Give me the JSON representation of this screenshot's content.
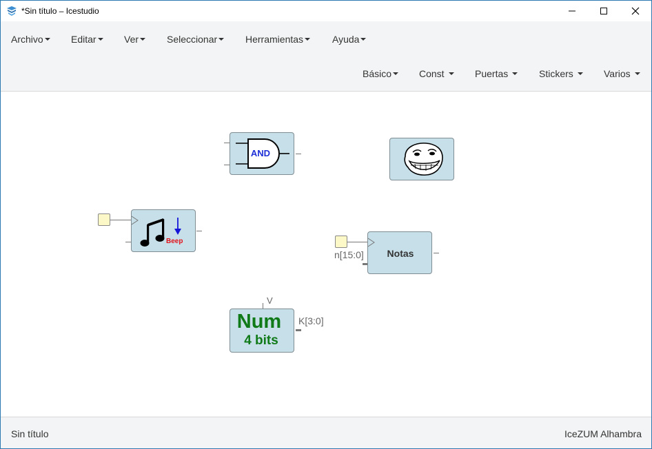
{
  "window": {
    "title": "*Sin título – Icestudio"
  },
  "menu": {
    "main": [
      "Archivo",
      "Editar",
      "Ver",
      "Seleccionar",
      "Herramientas",
      "Ayuda"
    ],
    "blocks": [
      "Básico",
      "Const",
      "Puertas",
      "Stickers",
      "Varios"
    ]
  },
  "canvas": {
    "and_gate": {
      "label": "AND",
      "icon": "and-gate-icon"
    },
    "sticker": {
      "icon": "troll-face-icon"
    },
    "beep_block": {
      "label": "Beep",
      "icon": "music-note-icon"
    },
    "notas_block": {
      "title": "Notas",
      "input_label": "n[15:0]"
    },
    "num_block": {
      "line1": "Num",
      "line2": "4 bits",
      "param_label": "V",
      "output_label": "K[3:0]"
    }
  },
  "status": {
    "left": "Sin título",
    "right": "IceZUM Alhambra"
  },
  "colors": {
    "block_fill": "#c6dfe9",
    "input_pin_fill": "#fdf8c8",
    "num_text": "#0f7a17",
    "and_text": "#1c2fd6",
    "beep_text": "#e3131b"
  }
}
